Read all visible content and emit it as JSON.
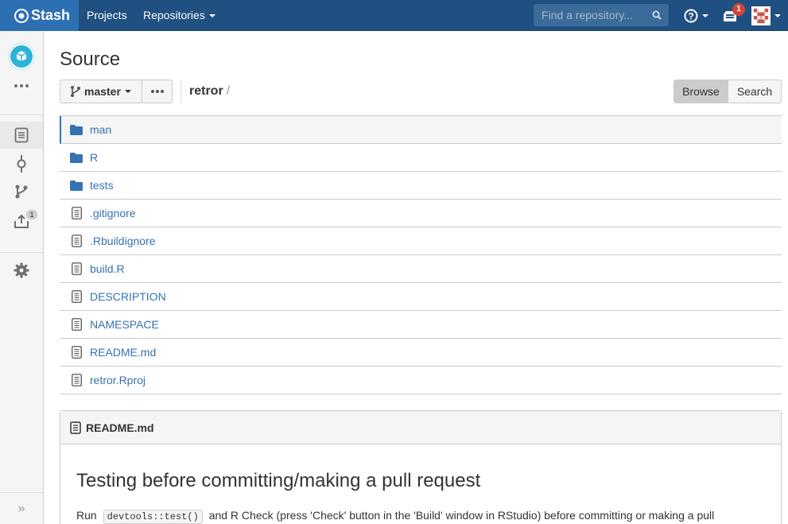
{
  "header": {
    "logo_text": "Stash",
    "nav": [
      "Projects",
      "Repositories"
    ],
    "search_placeholder": "Find a repository...",
    "notification_count": "1",
    "brand_color": "#205081"
  },
  "sidebar": {
    "upload_badge": "1"
  },
  "main": {
    "title": "Source",
    "branch": "master",
    "repo": "retror",
    "crumb_slash": "/",
    "view_toggle": {
      "browse": "Browse",
      "search": "Search"
    },
    "files": [
      {
        "name": "man",
        "type": "folder"
      },
      {
        "name": "R",
        "type": "folder"
      },
      {
        "name": "tests",
        "type": "folder"
      },
      {
        "name": ".gitignore",
        "type": "file"
      },
      {
        "name": ".Rbuildignore",
        "type": "file"
      },
      {
        "name": "build.R",
        "type": "file"
      },
      {
        "name": "DESCRIPTION",
        "type": "file"
      },
      {
        "name": "NAMESPACE",
        "type": "file"
      },
      {
        "name": "README.md",
        "type": "file"
      },
      {
        "name": "retror.Rproj",
        "type": "file"
      }
    ]
  },
  "readme": {
    "filename": "README.md",
    "heading": "Testing before committing/making a pull request",
    "para_prefix": "Run",
    "para_code": "devtools::test()",
    "para_suffix": "and R Check (press 'Check' button in the 'Build' window in RStudio) before committing or making a pull"
  }
}
